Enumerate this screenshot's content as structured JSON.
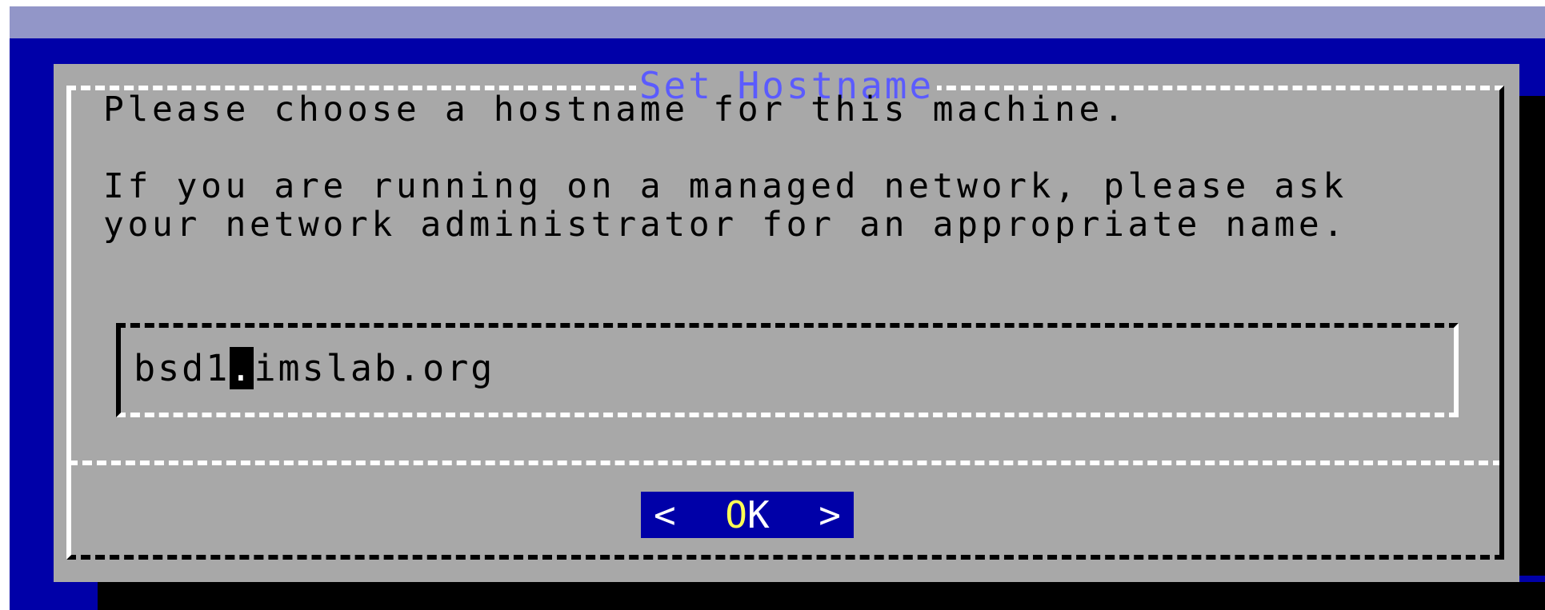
{
  "dialog": {
    "title": "Set Hostname",
    "message_line1": "Please choose a hostname for this machine.",
    "message_line2": "If you are running on a managed network, please ask",
    "message_line3": "your network administrator for an appropriate name."
  },
  "hostname_input": {
    "value_before_cursor": "bsd1",
    "value_at_cursor": ".",
    "value_after_cursor": "imslab.org"
  },
  "ok_button": {
    "left_bracket": "<",
    "hotkey_letter": "O",
    "rest_label": "K",
    "right_bracket": ">"
  },
  "colors": {
    "background": "#0000a8",
    "dialog": "#a8a8a8",
    "title": "#5b5bff",
    "button_bg": "#0000a8",
    "hotkey": "#ffff54"
  }
}
